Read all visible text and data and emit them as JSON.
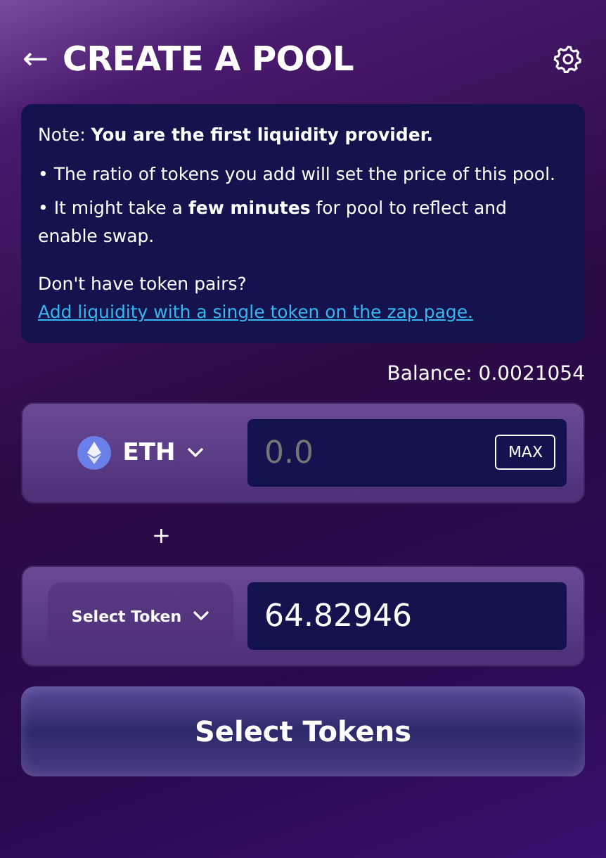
{
  "header": {
    "back_icon": "←",
    "title": "CREATE A POOL"
  },
  "note": {
    "lead": "Note: **You are the first liquidity provider.**",
    "bullets": [
      "• The ratio of tokens you add will set the price of this pool.",
      "• It might take a **few minutes** for pool to reflect and enable swap."
    ],
    "question": "Don't have token pairs?",
    "link": "Add liquidity with a single token on the zap page."
  },
  "balance": "Balance: 0.0021054",
  "inputs": [
    {
      "kind": "token",
      "token": "ETH",
      "amount": {
        "placeholder": "0.0"
      },
      "max_button": "MAX"
    },
    {
      "kind": "select",
      "token": "Select Token",
      "amount": {
        "value": "64.82946"
      }
    }
  ],
  "plus": "+",
  "submit_button": "Select Tokens"
}
